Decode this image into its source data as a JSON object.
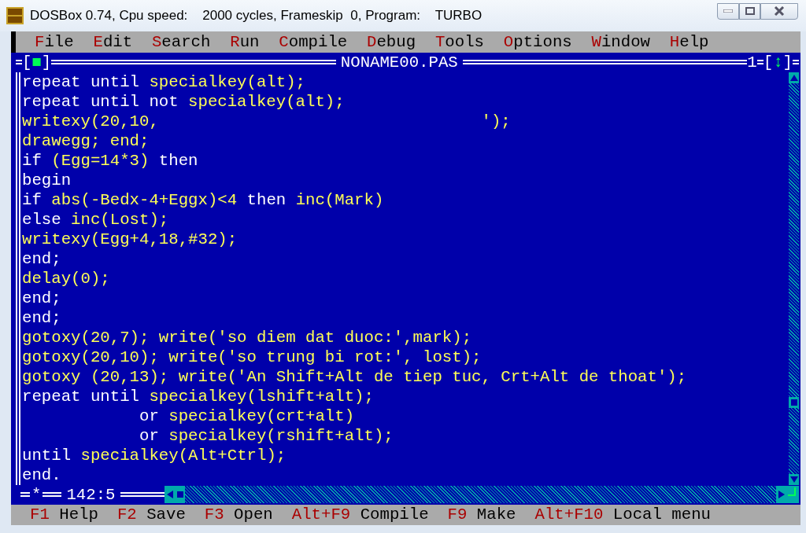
{
  "window": {
    "title": "DOSBox 0.74, Cpu speed:    2000 cycles, Frameskip  0, Program:    TURBO"
  },
  "menu": [
    {
      "label": "File"
    },
    {
      "label": "Edit"
    },
    {
      "label": "Search"
    },
    {
      "label": "Run"
    },
    {
      "label": "Compile"
    },
    {
      "label": "Debug"
    },
    {
      "label": "Tools"
    },
    {
      "label": "Options"
    },
    {
      "label": "Window"
    },
    {
      "label": "Help"
    }
  ],
  "editor": {
    "close_box": "[■]",
    "title": "NONAME00.PAS",
    "window_number": "1",
    "zoom_box": "[↕]",
    "lines": [
      [
        {
          "kind": "keyword",
          "text": "repeat until "
        },
        {
          "kind": "text",
          "text": "specialkey(alt);"
        }
      ],
      [
        {
          "kind": "keyword",
          "text": "repeat until not "
        },
        {
          "kind": "text",
          "text": "specialkey(alt);"
        }
      ],
      [
        {
          "kind": "text",
          "text": "writexy(20,10,                                 ');"
        }
      ],
      [
        {
          "kind": "text",
          "text": "drawegg; end;"
        }
      ],
      [
        {
          "kind": "keyword",
          "text": "if "
        },
        {
          "kind": "text",
          "text": "(Egg=14*3) "
        },
        {
          "kind": "keyword",
          "text": "then"
        }
      ],
      [
        {
          "kind": "keyword",
          "text": "begin"
        }
      ],
      [
        {
          "kind": "keyword",
          "text": "if "
        },
        {
          "kind": "text",
          "text": "abs(-Bedx-4+Eggx)<4 "
        },
        {
          "kind": "keyword",
          "text": "then "
        },
        {
          "kind": "text",
          "text": "inc(Mark)"
        }
      ],
      [
        {
          "kind": "keyword",
          "text": "else "
        },
        {
          "kind": "text",
          "text": "inc(Lost);"
        }
      ],
      [
        {
          "kind": "text",
          "text": "writexy(Egg+4,18,#32);"
        }
      ],
      [
        {
          "kind": "keyword",
          "text": "end;"
        }
      ],
      [
        {
          "kind": "text",
          "text": "delay(0);"
        }
      ],
      [
        {
          "kind": "keyword",
          "text": "end;"
        }
      ],
      [
        {
          "kind": "keyword",
          "text": "end;"
        }
      ],
      [
        {
          "kind": "text",
          "text": "gotoxy(20,7); write('so diem dat duoc:',mark);"
        }
      ],
      [
        {
          "kind": "text",
          "text": "gotoxy(20,10); write('so trung bi rot:', lost);"
        }
      ],
      [
        {
          "kind": "text",
          "text": "gotoxy (20,13); write('An Shift+Alt de tiep tuc, Crt+Alt de thoat');"
        }
      ],
      [
        {
          "kind": "keyword",
          "text": "repeat until "
        },
        {
          "kind": "text",
          "text": "specialkey(lshift+alt);"
        }
      ],
      [
        {
          "kind": "keyword",
          "text": "            or "
        },
        {
          "kind": "text",
          "text": "specialkey(crt+alt)"
        }
      ],
      [
        {
          "kind": "keyword",
          "text": "            or "
        },
        {
          "kind": "text",
          "text": "specialkey(rshift+alt);"
        }
      ],
      [
        {
          "kind": "keyword",
          "text": "until "
        },
        {
          "kind": "text",
          "text": "specialkey(Alt+Ctrl);"
        }
      ],
      [
        {
          "kind": "keyword",
          "text": "end."
        }
      ]
    ],
    "modified_mark": "*",
    "cursor_position": "142:5"
  },
  "status_bar": [
    {
      "key": "F1",
      "label": "Help"
    },
    {
      "key": "F2",
      "label": "Save"
    },
    {
      "key": "F3",
      "label": "Open"
    },
    {
      "key": "Alt+F9",
      "label": "Compile"
    },
    {
      "key": "F9",
      "label": "Make"
    },
    {
      "key": "Alt+F10",
      "label": "Local menu"
    }
  ]
}
